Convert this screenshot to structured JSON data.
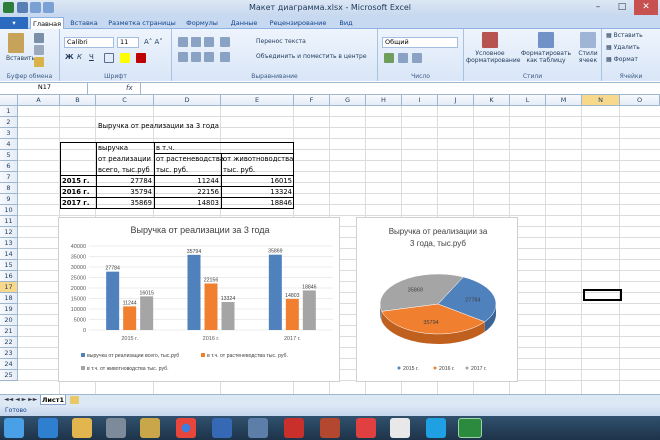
{
  "window": {
    "title": "Макет диаграмма.xlsx - Microsoft Excel"
  },
  "tabs": [
    "Главная",
    "Вставка",
    "Разметка страницы",
    "Формулы",
    "Данные",
    "Рецензирование",
    "Вид"
  ],
  "ribbon": {
    "clipboard": {
      "paste": "Вставить",
      "label": "Буфер обмена"
    },
    "font": {
      "name": "Calibri",
      "size": "11",
      "label": "Шрифт",
      "bold": "Ж",
      "italic": "К",
      "underline": "Ч"
    },
    "alignment": {
      "wrap": "Перенос текста",
      "merge": "Объединить и поместить в центре",
      "label": "Выравнивание"
    },
    "number": {
      "format": "Общий",
      "label": "Число"
    },
    "styles": {
      "conditional": "Условное форматирование",
      "table": "Форматировать как таблицу",
      "cell": "Стили ячеек",
      "label": "Стили"
    },
    "cells": {
      "insert": "Вставить",
      "delete": "Удалить",
      "format": "Формат",
      "label": "Ячейки"
    }
  },
  "formula_bar": {
    "name_box": "N17",
    "fx": "fx",
    "value": ""
  },
  "columns": [
    "A",
    "B",
    "C",
    "D",
    "E",
    "F",
    "G",
    "H",
    "I",
    "J",
    "K",
    "L",
    "M",
    "N",
    "O"
  ],
  "rows": [
    "1",
    "2",
    "3",
    "4",
    "5",
    "6",
    "7",
    "8",
    "9",
    "10",
    "11",
    "12",
    "13",
    "14",
    "15",
    "16",
    "17",
    "18",
    "19",
    "20",
    "21",
    "22",
    "23",
    "24",
    "25"
  ],
  "sheet": {
    "title": "Выручка от реализации за 3 года",
    "header_c4": "выручка",
    "header_c5": "от реализации",
    "header_c6": "всего, тыс.руб",
    "header_d4": "в т.ч.",
    "header_d5": "от растеневодства",
    "header_d6": "тыс. руб.",
    "header_e5": "от животноводства",
    "header_e6": "тыс. руб.",
    "years": [
      "2015 г.",
      "2016 г.",
      "2017 г."
    ],
    "total": [
      "27784",
      "35794",
      "35869"
    ],
    "crop": [
      "11244",
      "22156",
      "14803"
    ],
    "livestock": [
      "16015",
      "13324",
      "18846"
    ]
  },
  "chart_data": [
    {
      "type": "bar",
      "title": "Выручка от реализации за 3 года",
      "categories": [
        "2015 г.",
        "2016 г.",
        "2017 г."
      ],
      "series": [
        {
          "name": "выручка  от реализации всего, тыс.руб",
          "values": [
            27784,
            35794,
            35869
          ],
          "color": "#4f81bd"
        },
        {
          "name": "в т.ч. от растеневодства тыс. руб.",
          "values": [
            11244,
            22156,
            14803
          ],
          "color": "#f07f30"
        },
        {
          "name": "в т.ч. от животноводства тыс. руб.",
          "values": [
            16015,
            13324,
            18846
          ],
          "color": "#a5a5a5"
        }
      ],
      "ylim": [
        0,
        40000
      ],
      "yticks": [
        "0",
        "5000",
        "10000",
        "15000",
        "20000",
        "25000",
        "30000",
        "35000",
        "40000"
      ],
      "grid": true,
      "legend": "bottom"
    },
    {
      "type": "pie",
      "title": "Выручка от реализации за 3 года, тыс.руб",
      "categories": [
        "2015 г.",
        "2016 г.",
        "2017 г."
      ],
      "values": [
        27784,
        35794,
        35869
      ],
      "colors": [
        "#4f81bd",
        "#f07f30",
        "#a5a5a5"
      ],
      "legend": "bottom"
    }
  ],
  "sheet_tabs": {
    "active": "Лист1"
  },
  "status": {
    "ready": "Готово"
  }
}
